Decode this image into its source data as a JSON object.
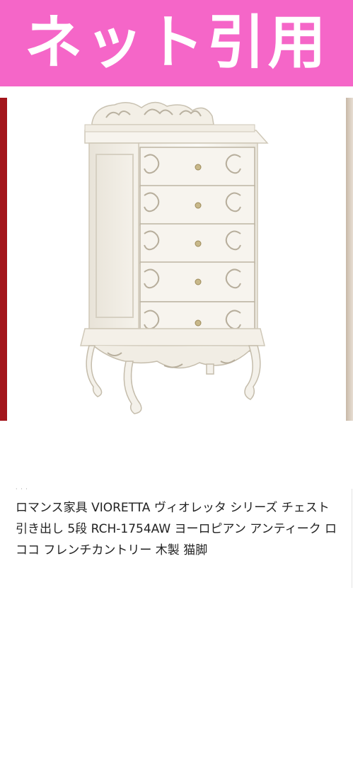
{
  "banner": {
    "text": "ネット引用",
    "color": "#f566c8"
  },
  "product": {
    "image_icon": "white-rococo-chest-of-drawers-image",
    "caption_dots": "· · ·",
    "title": "ロマンス家具 VIORETTA ヴィオレッタ シリーズ チェスト 引き出し 5段 RCH-1754AW ヨーロピアン アンティーク ロココ フレンチカントリー 木製 猫脚"
  }
}
